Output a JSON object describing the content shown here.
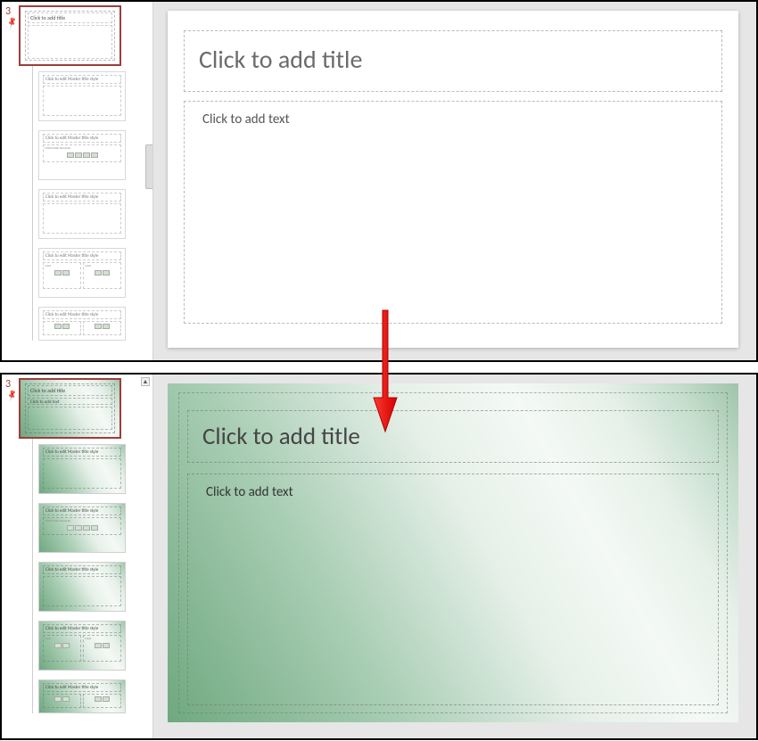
{
  "top": {
    "master_number": "3",
    "master_thumb_title": "Click to add title",
    "slide": {
      "title_placeholder": "Click to add title",
      "body_placeholder": "Click to add text"
    },
    "layouts": [
      {
        "title": "Click to edit Master title style",
        "type": "title-content"
      },
      {
        "title": "Click to edit Master title style",
        "type": "content-boxes"
      },
      {
        "title": "Click to edit Master title style",
        "type": "title-content"
      },
      {
        "title": "Click to edit Master title style",
        "type": "two-content"
      },
      {
        "title": "Click to edit Master title style",
        "type": "two-content-partial"
      }
    ]
  },
  "bottom": {
    "master_number": "3",
    "master_thumb_title": "Click to add title",
    "master_thumb_sub": "Click to add text",
    "slide": {
      "title_placeholder": "Click to add title",
      "body_placeholder": "Click to add text"
    },
    "layouts": [
      {
        "title": "Click to edit Master title style",
        "type": "title-content"
      },
      {
        "title": "Click to edit Master title style",
        "type": "content-boxes"
      },
      {
        "title": "Click to edit Master title style",
        "type": "title-content"
      },
      {
        "title": "Click to edit Master title style",
        "type": "two-content"
      },
      {
        "title": "Click to edit Master title style",
        "type": "two-content-partial"
      }
    ]
  },
  "colors": {
    "selection_border": "#9d3c3c",
    "green_start": "#6fa880",
    "green_end": "#e6f0e9"
  }
}
